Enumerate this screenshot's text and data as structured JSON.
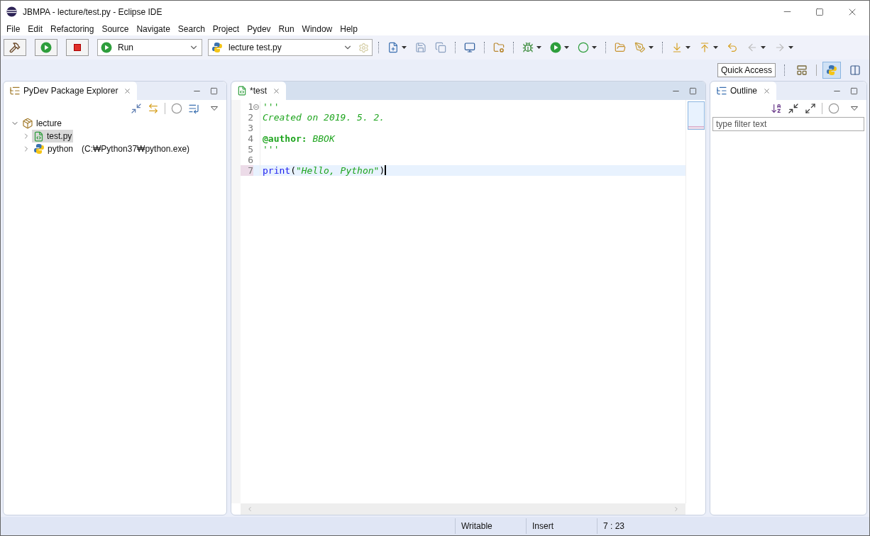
{
  "window": {
    "title": "JBMPA - lecture/test.py - Eclipse IDE"
  },
  "menu": [
    "File",
    "Edit",
    "Refactoring",
    "Source",
    "Navigate",
    "Search",
    "Project",
    "Pydev",
    "Run",
    "Window",
    "Help"
  ],
  "toolbar": {
    "launch_mode": "Run",
    "launch_config": "lecture test.py"
  },
  "quick_access": "Quick Access",
  "perspectives": [
    {
      "kind": "python",
      "selected": true
    },
    {
      "kind": "java",
      "selected": false
    }
  ],
  "package_explorer": {
    "title": "PyDev Package Explorer",
    "tree": [
      {
        "label": "lecture",
        "kind": "project",
        "expanded": true,
        "selected": false,
        "children": [
          {
            "label": "test.py",
            "kind": "file",
            "expanded": false,
            "selected": true
          },
          {
            "label": "python",
            "detail": "(C:₩Python37₩python.exe)",
            "kind": "interpreter",
            "expanded": false,
            "selected": false
          }
        ]
      }
    ]
  },
  "editor": {
    "tab": {
      "label": "*test",
      "selected": true
    },
    "lines": [
      {
        "number": "1",
        "current": false,
        "folded": false,
        "tokens": [
          {
            "kind": "comment",
            "text": "'''"
          }
        ]
      },
      {
        "number": "2",
        "current": false,
        "tokens": [
          {
            "kind": "comment",
            "text": "Created on 2019. 5. 2."
          }
        ]
      },
      {
        "number": "3",
        "current": false
      },
      {
        "number": "4",
        "current": false,
        "tokens": [
          {
            "kind": "decorator",
            "text": "@author:"
          },
          {
            "kind": "comment",
            "text": " BBOK"
          }
        ]
      },
      {
        "number": "5",
        "current": false,
        "tokens": [
          {
            "kind": "comment",
            "text": "'''"
          }
        ]
      },
      {
        "number": "6",
        "current": false
      },
      {
        "number": "7",
        "current": true,
        "tokens": [
          {
            "kind": "keyword",
            "text": "print"
          },
          {
            "kind": "paren",
            "text": "("
          },
          {
            "kind": "string",
            "text": "\"Hello, Python\""
          },
          {
            "kind": "paren",
            "text": ")"
          }
        ]
      }
    ]
  },
  "outline": {
    "title": "Outline",
    "filter_placeholder": "type filter text"
  },
  "status_bar": [
    "Writable",
    "Insert",
    "7 : 23"
  ]
}
